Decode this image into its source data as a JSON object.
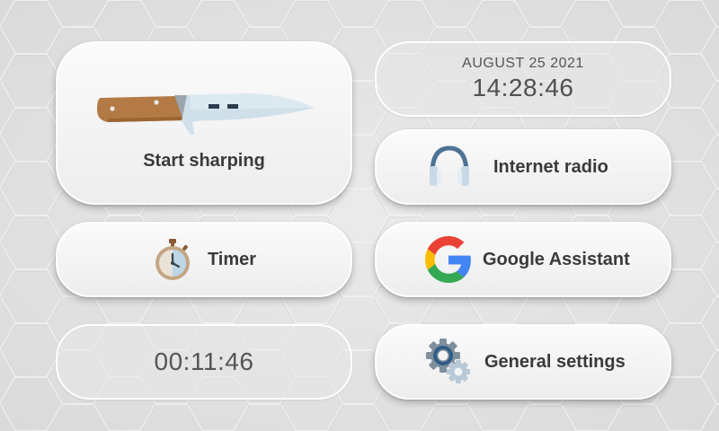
{
  "tiles": {
    "sharpen": {
      "label": "Start sharping",
      "icon": "knife-icon"
    },
    "datetime": {
      "date": "AUGUST 25 2021",
      "time": "14:28:46"
    },
    "radio": {
      "label": "Internet radio",
      "icon": "headphones-icon"
    },
    "timer": {
      "label": "Timer",
      "icon": "stopwatch-icon"
    },
    "assistant": {
      "label": "Google Assistant",
      "icon": "google-logo-icon"
    },
    "countdown": {
      "value": "00:11:46"
    },
    "settings": {
      "label": "General settings",
      "icon": "gears-icon"
    }
  },
  "colors": {
    "background": "#e6e6e6",
    "tile": "#f4f4f4",
    "text": "#3a3a3a",
    "knife_handle": "#b37a45",
    "knife_blade": "#cfe0ea",
    "headphones": "#4c7396"
  }
}
